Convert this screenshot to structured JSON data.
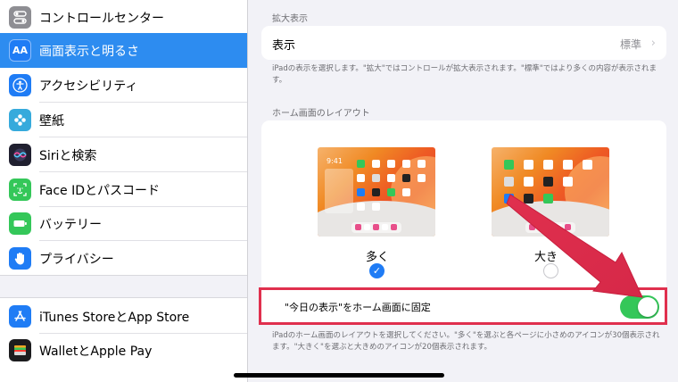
{
  "sidebar": {
    "items": [
      {
        "label": "コントロールセンター",
        "icon": "control-center-icon",
        "color": "#8e8e93",
        "glyph": "⚙"
      },
      {
        "label": "画面表示と明るさ",
        "icon": "display-brightness-icon",
        "color": "#1f7cf5",
        "glyph": "AA",
        "selected": true
      },
      {
        "label": "アクセシビリティ",
        "icon": "accessibility-icon",
        "color": "#1f7cf5",
        "glyph": "☺"
      },
      {
        "label": "壁紙",
        "icon": "wallpaper-icon",
        "color": "#36aadc",
        "glyph": "✿"
      },
      {
        "label": "Siriと検索",
        "icon": "siri-icon",
        "color": "#202030",
        "glyph": "◉"
      },
      {
        "label": "Face IDとパスコード",
        "icon": "face-id-icon",
        "color": "#34c759",
        "glyph": "☻"
      },
      {
        "label": "バッテリー",
        "icon": "battery-icon",
        "color": "#34c759",
        "glyph": "▬"
      },
      {
        "label": "プライバシー",
        "icon": "privacy-hand-icon",
        "color": "#1f7cf5",
        "glyph": "✋"
      }
    ],
    "items2": [
      {
        "label": "iTunes StoreとApp Store",
        "icon": "app-store-icon",
        "color": "#1f7cf5",
        "glyph": "A"
      },
      {
        "label": "WalletとApple Pay",
        "icon": "wallet-icon",
        "color": "#1c1c1e",
        "glyph": "▤"
      }
    ]
  },
  "main": {
    "zoom_section": {
      "header": "拡大表示",
      "row_label": "表示",
      "row_value": "標準",
      "note": "iPadの表示を選択します。\"拡大\"ではコントロールが拡大表示されます。\"標準\"ではより多くの内容が表示されます。"
    },
    "layout_section": {
      "header": "ホーム画面のレイアウト",
      "option_more": "多く",
      "option_bigger": "大き",
      "preview_time": "9:41",
      "selected": "more",
      "toggle_label": "\"今日の表示\"をホーム画面に固定",
      "toggle_on": true,
      "note": "iPadのホーム画面のレイアウトを選択してください。\"多く\"を選ぶと各ページに小さめのアイコンが30個表示されます。\"大きく\"を選ぶと大きめのアイコンが20個表示されます。"
    }
  },
  "colors": {
    "accent": "#1f7cf5",
    "selected_row": "#2d8cf0",
    "toggle_on": "#34c759",
    "annotation": "#e0304e"
  }
}
